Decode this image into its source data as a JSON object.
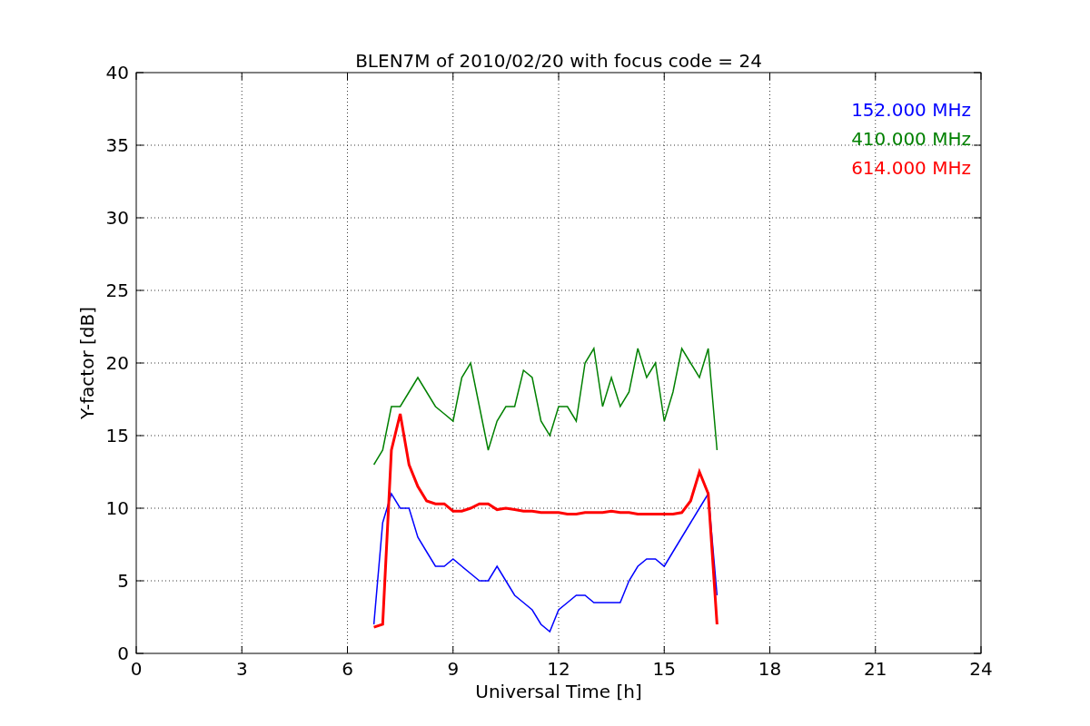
{
  "chart_data": {
    "type": "line",
    "title": "BLEN7M of 2010/02/20 with focus code = 24",
    "xlabel": "Universal Time [h]",
    "ylabel": "Y-factor [dB]",
    "x": [
      6.75,
      7.0,
      7.25,
      7.5,
      7.75,
      8.0,
      8.25,
      8.5,
      8.75,
      9.0,
      9.25,
      9.5,
      9.75,
      10.0,
      10.25,
      10.5,
      10.75,
      11.0,
      11.25,
      11.5,
      11.75,
      12.0,
      12.25,
      12.5,
      12.75,
      13.0,
      13.25,
      13.5,
      13.75,
      14.0,
      14.25,
      14.5,
      14.75,
      15.0,
      15.25,
      15.5,
      15.75,
      16.0,
      16.25,
      16.5
    ],
    "series": [
      {
        "name": "152.000 MHz",
        "color": "#0000ff",
        "values": [
          2,
          9,
          11,
          10,
          10,
          8,
          7,
          6,
          6,
          6.5,
          6,
          5.5,
          5,
          5,
          6,
          5,
          4,
          3.5,
          3,
          2,
          1.5,
          3,
          3.5,
          4,
          4,
          3.5,
          3.5,
          3.5,
          3.5,
          5,
          6,
          6.5,
          6.5,
          6,
          7,
          8,
          9,
          10,
          11,
          4
        ]
      },
      {
        "name": "410.000 MHz",
        "color": "#008000",
        "values": [
          13,
          14,
          17,
          17,
          18,
          19,
          18,
          17,
          16.5,
          16,
          19,
          20,
          17,
          14,
          16,
          17,
          17,
          19.5,
          19,
          16,
          15,
          17,
          17,
          16,
          20,
          21,
          17,
          19,
          17,
          18,
          21,
          19,
          20,
          16,
          18,
          21,
          20,
          19,
          21,
          14
        ]
      },
      {
        "name": "614.000 MHz",
        "color": "#ff0000",
        "values": [
          1.8,
          2,
          14,
          16.5,
          13,
          11.5,
          10.5,
          10.3,
          10.3,
          9.8,
          9.8,
          10,
          10.3,
          10.3,
          9.9,
          10,
          9.9,
          9.8,
          9.8,
          9.7,
          9.7,
          9.7,
          9.6,
          9.6,
          9.7,
          9.7,
          9.7,
          9.8,
          9.7,
          9.7,
          9.6,
          9.6,
          9.6,
          9.6,
          9.6,
          9.7,
          10.5,
          12.5,
          11,
          2
        ]
      }
    ],
    "grid": true,
    "xlim": [
      0,
      24
    ],
    "ylim": [
      0,
      40
    ],
    "xticks": [
      0,
      3,
      6,
      9,
      12,
      15,
      18,
      21,
      24
    ],
    "yticks": [
      0,
      5,
      10,
      15,
      20,
      25,
      30,
      35,
      40
    ]
  }
}
